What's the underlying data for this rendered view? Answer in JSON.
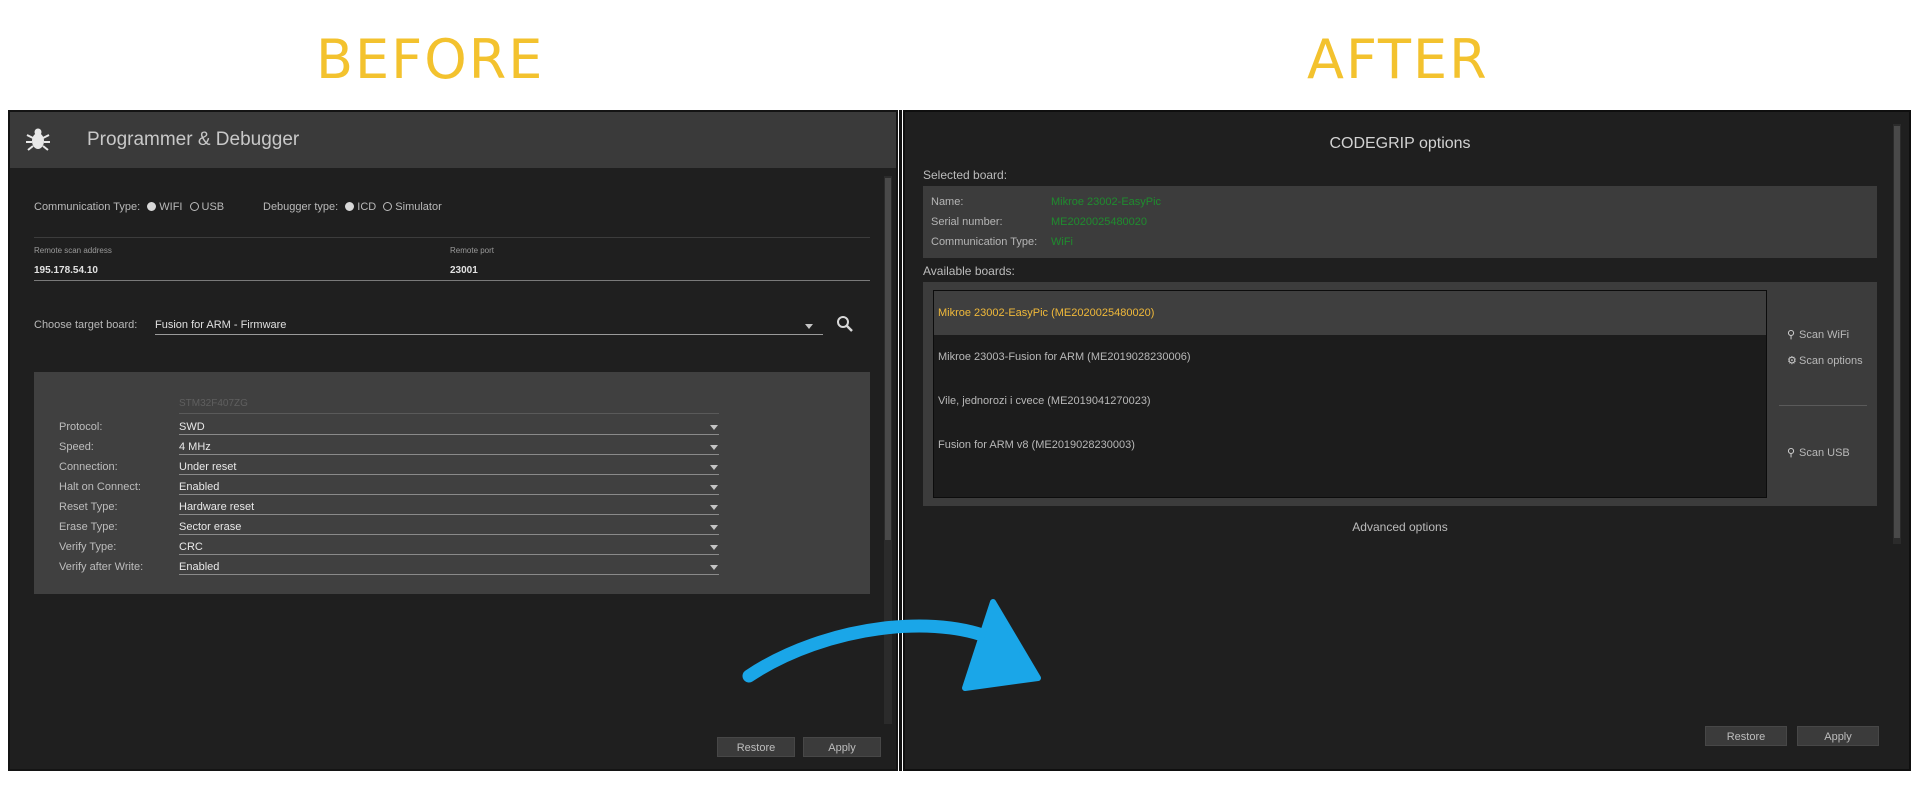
{
  "headings": {
    "before": "BEFORE",
    "after": "AFTER"
  },
  "colors": {
    "heading": "#f3c22e",
    "arrow": "#1aa6e8",
    "selected_text": "#f0b93a",
    "green_value": "#1f8c2e"
  },
  "before": {
    "title": "Programmer & Debugger",
    "comm_type_label": "Communication Type:",
    "comm_options": [
      "WIFI",
      "USB"
    ],
    "comm_selected": "WIFI",
    "debugger_type_label": "Debugger type:",
    "debugger_options": [
      "ICD",
      "Simulator"
    ],
    "debugger_selected": "ICD",
    "remote_address_label": "Remote scan address",
    "remote_address_value": "195.178.54.10",
    "remote_port_label": "Remote port",
    "remote_port_value": "23001",
    "target_label": "Choose target board:",
    "target_value": "Fusion for ARM - Firmware",
    "chip_label": "STM32F407ZG",
    "settings": [
      {
        "label": "Protocol:",
        "value": "SWD"
      },
      {
        "label": "Speed:",
        "value": "4 MHz"
      },
      {
        "label": "Connection:",
        "value": "Under reset"
      },
      {
        "label": "Halt on Connect:",
        "value": "Enabled"
      },
      {
        "label": "Reset Type:",
        "value": "Hardware reset"
      },
      {
        "label": "Erase Type:",
        "value": "Sector erase"
      },
      {
        "label": "Verify Type:",
        "value": "CRC"
      },
      {
        "label": "Verify after Write:",
        "value": "Enabled"
      }
    ],
    "restore_label": "Restore",
    "apply_label": "Apply"
  },
  "after": {
    "title": "CODEGRIP options",
    "selected_board_label": "Selected board:",
    "name_key": "Name:",
    "name_value": "Mikroe 23002-EasyPic",
    "serial_key": "Serial number:",
    "serial_value": "ME2020025480020",
    "comm_key": "Communication Type:",
    "comm_value": "WiFi",
    "available_label": "Available boards:",
    "boards": [
      "Mikroe 23002-EasyPic (ME2020025480020)",
      "Mikroe 23003-Fusion for ARM (ME2019028230006)",
      "Vile, jednorozi i cvece (ME2019041270023)",
      "Fusion for ARM v8 (ME2019028230003)"
    ],
    "selected_index": 0,
    "scan_wifi_label": "Scan WiFi",
    "scan_options_label": "Scan options",
    "scan_usb_label": "Scan USB",
    "advanced_label": "Advanced options",
    "restore_label": "Restore",
    "apply_label": "Apply"
  }
}
